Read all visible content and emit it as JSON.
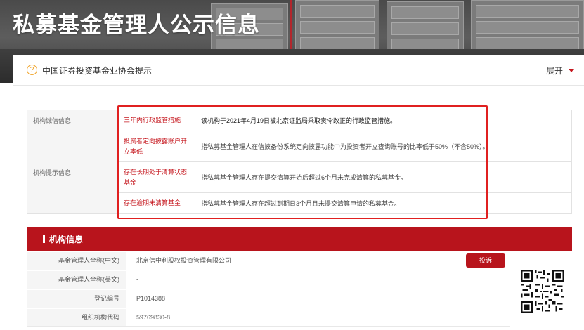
{
  "banner": {
    "title": "私募基金管理人公示信息"
  },
  "notice": {
    "text": "中国证券投资基金业协会提示",
    "expand": "展开",
    "q": "?"
  },
  "info_table": {
    "integrity_label": "机构诚信信息",
    "hints_label": "机构提示信息",
    "rows": [
      {
        "item": "三年内行政监管措施",
        "desc": "该机构于2021年4月19日被北京证监局采取责令改正的行政监管措施。"
      },
      {
        "item": "投资者定向披露账户开立率低",
        "desc": "指私募基金管理人在信披备份系统定向披露功能中为投资者开立查询账号的比率低于50%（不含50%）。"
      },
      {
        "item": "存在长期处于清算状态基金",
        "desc": "指私募基金管理人存在提交清算开始后超过6个月未完成清算的私募基金。"
      },
      {
        "item": "存在逾期未清算基金",
        "desc": "指私募基金管理人存在超过到期日3个月且未提交清算申请的私募基金。"
      }
    ]
  },
  "org": {
    "title": "机构信息",
    "report_button": "投诉",
    "rows": [
      {
        "key": "基金管理人全称(中文)",
        "value": "北京信中利股权投资管理有限公司"
      },
      {
        "key": "基金管理人全称(英文)",
        "value": "-"
      },
      {
        "key": "登记编号",
        "value": "P1014388"
      },
      {
        "key": "组织机构代码",
        "value": "59769830-8"
      }
    ]
  },
  "colors": {
    "accent": "#b8141c",
    "highlight": "#e02020",
    "warning": "#c5161d"
  }
}
